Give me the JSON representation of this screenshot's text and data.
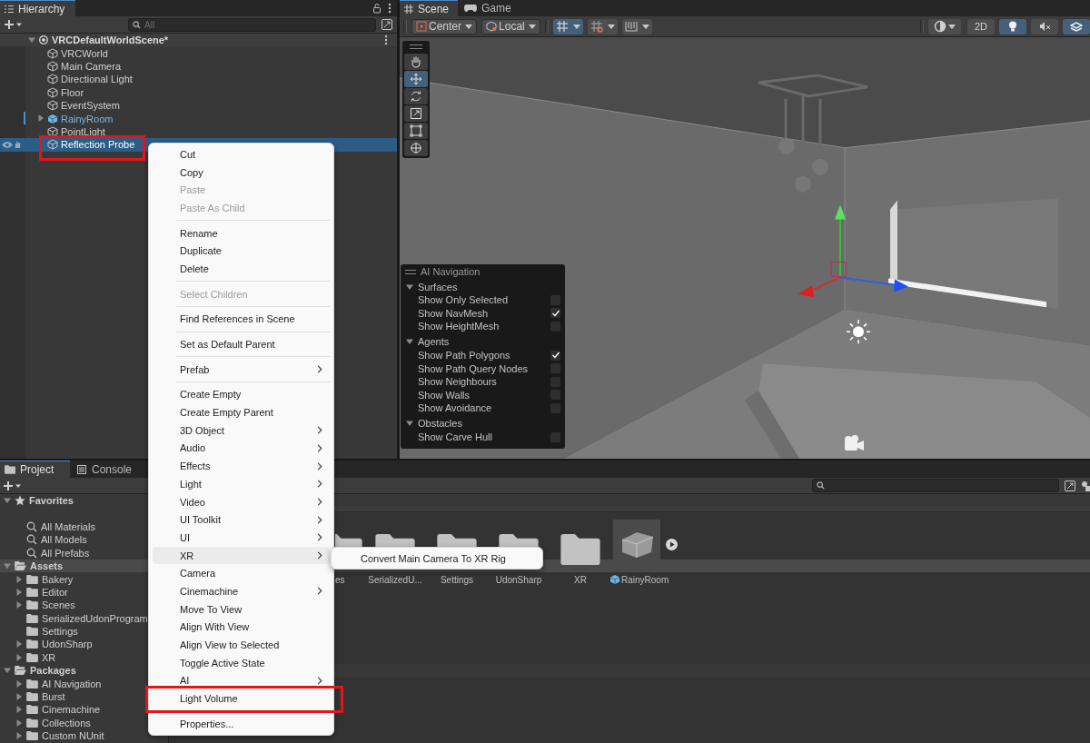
{
  "hierarchy": {
    "title": "Hierarchy",
    "search": {
      "placeholder": "All"
    },
    "scene": {
      "name": "VRCDefaultWorldScene*",
      "expanded": true
    },
    "items": [
      {
        "name": "VRCWorld",
        "kind": "object",
        "selected": false,
        "highlighted": false
      },
      {
        "name": "Main Camera",
        "kind": "object",
        "selected": false,
        "highlighted": false
      },
      {
        "name": "Directional Light",
        "kind": "object",
        "selected": false,
        "highlighted": false
      },
      {
        "name": "Floor",
        "kind": "object",
        "selected": false,
        "highlighted": false
      },
      {
        "name": "EventSystem",
        "kind": "object",
        "selected": false,
        "highlighted": false
      },
      {
        "name": "RainyRoom",
        "kind": "prefab",
        "selected": false,
        "highlighted": false
      },
      {
        "name": "PointLight",
        "kind": "object",
        "selected": false,
        "highlighted": false
      },
      {
        "name": "Reflection Probe",
        "kind": "object",
        "selected": true,
        "highlighted": true
      }
    ]
  },
  "scene_view": {
    "tabs": [
      {
        "label": "Scene",
        "kind": "scene",
        "selected": true
      },
      {
        "label": "Game",
        "kind": "game",
        "selected": false
      }
    ],
    "pivot_buttons": [
      {
        "label": "Center",
        "kind": "pivot"
      },
      {
        "label": "Local",
        "kind": "rotation"
      }
    ],
    "snap_buttons": [
      {
        "kind": "grid",
        "on": true
      },
      {
        "kind": "increment",
        "on": false
      },
      {
        "kind": "ruler",
        "on": false
      }
    ],
    "view_toggles": [
      {
        "kind": "shading",
        "on": false
      },
      {
        "kind": "mode2d",
        "label": "2D",
        "on": false
      },
      {
        "kind": "lighting",
        "on": true
      },
      {
        "kind": "audio",
        "on": false
      },
      {
        "kind": "effects",
        "on": true
      }
    ],
    "tools": [
      {
        "kind": "hand",
        "selected": false
      },
      {
        "kind": "move",
        "selected": true
      },
      {
        "kind": "rotate",
        "selected": false
      },
      {
        "kind": "scale",
        "selected": false
      },
      {
        "kind": "rect",
        "selected": false
      },
      {
        "kind": "transform",
        "selected": false
      }
    ],
    "ai_navigation": {
      "title": "AI Navigation",
      "sections": [
        {
          "name": "Surfaces",
          "expanded": true,
          "options": [
            {
              "label": "Show Only Selected",
              "checked": false
            },
            {
              "label": "Show NavMesh",
              "checked": true
            },
            {
              "label": "Show HeightMesh",
              "checked": false
            }
          ]
        },
        {
          "name": "Agents",
          "expanded": true,
          "options": [
            {
              "label": "Show Path Polygons",
              "checked": true
            },
            {
              "label": "Show Path Query Nodes",
              "checked": false
            },
            {
              "label": "Show Neighbours",
              "checked": false
            },
            {
              "label": "Show Walls",
              "checked": false
            },
            {
              "label": "Show Avoidance",
              "checked": false
            }
          ]
        },
        {
          "name": "Obstacles",
          "expanded": true,
          "options": [
            {
              "label": "Show Carve Hull",
              "checked": false
            }
          ]
        }
      ]
    }
  },
  "context_menu": {
    "items": [
      {
        "kind": "item",
        "label": "Cut",
        "disabled": false,
        "submenu": false,
        "hovered": false,
        "highlighted": false
      },
      {
        "kind": "item",
        "label": "Copy",
        "disabled": false,
        "submenu": false,
        "hovered": false,
        "highlighted": false
      },
      {
        "kind": "item",
        "label": "Paste",
        "disabled": true,
        "submenu": false,
        "hovered": false,
        "highlighted": false
      },
      {
        "kind": "item",
        "label": "Paste As Child",
        "disabled": true,
        "submenu": false,
        "hovered": false,
        "highlighted": false
      },
      {
        "kind": "separator"
      },
      {
        "kind": "item",
        "label": "Rename",
        "disabled": false,
        "submenu": false,
        "hovered": false,
        "highlighted": false
      },
      {
        "kind": "item",
        "label": "Duplicate",
        "disabled": false,
        "submenu": false,
        "hovered": false,
        "highlighted": false
      },
      {
        "kind": "item",
        "label": "Delete",
        "disabled": false,
        "submenu": false,
        "hovered": false,
        "highlighted": false
      },
      {
        "kind": "separator"
      },
      {
        "kind": "item",
        "label": "Select Children",
        "disabled": true,
        "submenu": false,
        "hovered": false,
        "highlighted": false
      },
      {
        "kind": "separator"
      },
      {
        "kind": "item",
        "label": "Find References in Scene",
        "disabled": false,
        "submenu": false,
        "hovered": false,
        "highlighted": false
      },
      {
        "kind": "separator"
      },
      {
        "kind": "item",
        "label": "Set as Default Parent",
        "disabled": false,
        "submenu": false,
        "hovered": false,
        "highlighted": false
      },
      {
        "kind": "separator"
      },
      {
        "kind": "item",
        "label": "Prefab",
        "disabled": false,
        "submenu": true,
        "hovered": false,
        "highlighted": false
      },
      {
        "kind": "separator"
      },
      {
        "kind": "item",
        "label": "Create Empty",
        "disabled": false,
        "submenu": false,
        "hovered": false,
        "highlighted": false
      },
      {
        "kind": "item",
        "label": "Create Empty Parent",
        "disabled": false,
        "submenu": false,
        "hovered": false,
        "highlighted": false
      },
      {
        "kind": "item",
        "label": "3D Object",
        "disabled": false,
        "submenu": true,
        "hovered": false,
        "highlighted": false
      },
      {
        "kind": "item",
        "label": "Audio",
        "disabled": false,
        "submenu": true,
        "hovered": false,
        "highlighted": false
      },
      {
        "kind": "item",
        "label": "Effects",
        "disabled": false,
        "submenu": true,
        "hovered": false,
        "highlighted": false
      },
      {
        "kind": "item",
        "label": "Light",
        "disabled": false,
        "submenu": true,
        "hovered": false,
        "highlighted": false
      },
      {
        "kind": "item",
        "label": "Video",
        "disabled": false,
        "submenu": true,
        "hovered": false,
        "highlighted": false
      },
      {
        "kind": "item",
        "label": "UI Toolkit",
        "disabled": false,
        "submenu": true,
        "hovered": false,
        "highlighted": false
      },
      {
        "kind": "item",
        "label": "UI",
        "disabled": false,
        "submenu": true,
        "hovered": false,
        "highlighted": false
      },
      {
        "kind": "item",
        "label": "XR",
        "disabled": false,
        "submenu": true,
        "hovered": true,
        "highlighted": false
      },
      {
        "kind": "item",
        "label": "Camera",
        "disabled": false,
        "submenu": false,
        "hovered": false,
        "highlighted": false
      },
      {
        "kind": "item",
        "label": "Cinemachine",
        "disabled": false,
        "submenu": true,
        "hovered": false,
        "highlighted": false
      },
      {
        "kind": "item",
        "label": "Move To View",
        "disabled": false,
        "submenu": false,
        "hovered": false,
        "highlighted": false
      },
      {
        "kind": "item",
        "label": "Align With View",
        "disabled": false,
        "submenu": false,
        "hovered": false,
        "highlighted": false
      },
      {
        "kind": "item",
        "label": "Align View to Selected",
        "disabled": false,
        "submenu": false,
        "hovered": false,
        "highlighted": false
      },
      {
        "kind": "item",
        "label": "Toggle Active State",
        "disabled": false,
        "submenu": false,
        "hovered": false,
        "highlighted": false
      },
      {
        "kind": "item",
        "label": "AI",
        "disabled": false,
        "submenu": true,
        "hovered": false,
        "highlighted": false
      },
      {
        "kind": "item",
        "label": "Light Volume",
        "disabled": false,
        "submenu": false,
        "hovered": false,
        "highlighted": true
      },
      {
        "kind": "separator"
      },
      {
        "kind": "item",
        "label": "Properties...",
        "disabled": false,
        "submenu": false,
        "hovered": false,
        "highlighted": false
      }
    ]
  },
  "submenu": {
    "items": [
      {
        "label": "Convert Main Camera To XR Rig"
      }
    ]
  },
  "project": {
    "tabs": [
      {
        "label": "Project",
        "kind": "project",
        "selected": true
      },
      {
        "label": "Console",
        "kind": "console",
        "selected": false
      }
    ],
    "tree": [
      {
        "label": "Favorites",
        "kind": "favorites",
        "selected": false,
        "expanded": true,
        "children": [
          {
            "label": "All Materials",
            "kind": "search",
            "selected": false
          },
          {
            "label": "All Models",
            "kind": "search",
            "selected": false
          },
          {
            "label": "All Prefabs",
            "kind": "search",
            "selected": false
          }
        ]
      },
      {
        "label": "Assets",
        "kind": "root",
        "selected": true,
        "expanded": true,
        "children": [
          {
            "label": "Bakery",
            "kind": "folder",
            "selected": false,
            "expandable": true
          },
          {
            "label": "Editor",
            "kind": "folder",
            "selected": false,
            "expandable": true
          },
          {
            "label": "Scenes",
            "kind": "folder",
            "selected": false,
            "expandable": true
          },
          {
            "label": "SerializedUdonProgram",
            "kind": "folder",
            "selected": false,
            "expandable": false
          },
          {
            "label": "Settings",
            "kind": "folder",
            "selected": false,
            "expandable": false
          },
          {
            "label": "UdonSharp",
            "kind": "folder",
            "selected": false,
            "expandable": true
          },
          {
            "label": "XR",
            "kind": "folder",
            "selected": false,
            "expandable": true
          }
        ]
      },
      {
        "label": "Packages",
        "kind": "root",
        "selected": false,
        "expanded": true,
        "children": [
          {
            "label": "AI Navigation",
            "kind": "folder",
            "selected": false,
            "expandable": true
          },
          {
            "label": "Burst",
            "kind": "folder",
            "selected": false,
            "expandable": true
          },
          {
            "label": "Cinemachine",
            "kind": "folder",
            "selected": false,
            "expandable": true
          },
          {
            "label": "Collections",
            "kind": "folder",
            "selected": false,
            "expandable": true
          },
          {
            "label": "Custom NUnit",
            "kind": "folder",
            "selected": false,
            "expandable": true
          }
        ]
      }
    ],
    "assets": [
      {
        "label": "es",
        "kind": "folder"
      },
      {
        "label": "SerializedU...",
        "kind": "folder"
      },
      {
        "label": "Settings",
        "kind": "folder"
      },
      {
        "label": "UdonSharp",
        "kind": "folder"
      },
      {
        "label": "XR",
        "kind": "folder"
      },
      {
        "label": "RainyRoom",
        "kind": "prefab"
      }
    ]
  }
}
